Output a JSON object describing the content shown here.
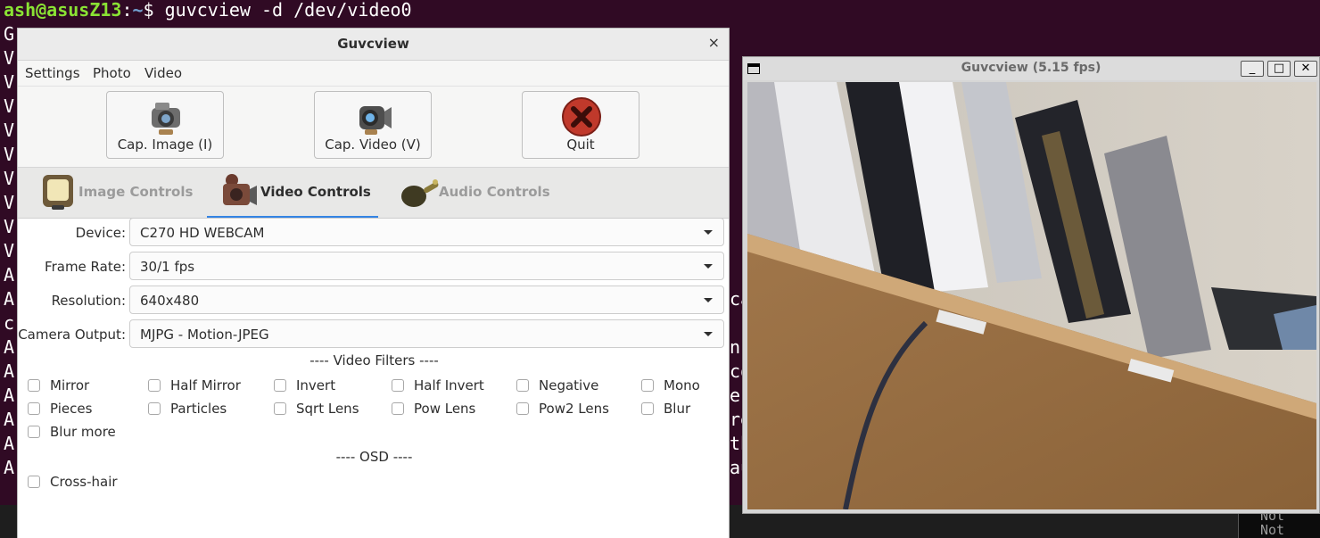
{
  "terminal": {
    "prompt_user": "ash@asusZ13",
    "prompt_sep": ":",
    "prompt_path": "~",
    "prompt_dollar": "$",
    "command": "guvcview -d /dev/video0",
    "left_fragments": [
      "G",
      "V",
      "V",
      "V",
      "V",
      "V",
      "V",
      "V",
      "V",
      "V",
      "A",
      "A",
      "c",
      "A",
      "A",
      "A",
      "A",
      "A",
      "A"
    ],
    "right_fragments": [
      "ca",
      "n",
      "co",
      "e",
      "re",
      "th",
      "au"
    ],
    "notification": [
      "Not",
      "Not"
    ]
  },
  "control_window": {
    "title": "Guvcview",
    "close_glyph": "×",
    "menu": [
      "Settings",
      "Photo",
      "Video"
    ],
    "toolbar": {
      "capture_image": "Cap. Image (I)",
      "capture_video": "Cap. Video (V)",
      "quit": "Quit"
    },
    "tabs": [
      {
        "label": "Image Controls",
        "active": false
      },
      {
        "label": "Video Controls",
        "active": true
      },
      {
        "label": "Audio Controls",
        "active": false
      }
    ],
    "form": {
      "device_label": "Device:",
      "device_value": "C270 HD WEBCAM",
      "frame_rate_label": "Frame Rate:",
      "frame_rate_value": "30/1 fps",
      "resolution_label": "Resolution:",
      "resolution_value": "640x480",
      "camera_output_label": "Camera Output:",
      "camera_output_value": "MJPG - Motion-JPEG"
    },
    "video_filters_title": "---- Video Filters ----",
    "filters": {
      "mirror": "Mirror",
      "half_mirror": "Half Mirror",
      "invert": "Invert",
      "half_invert": "Half Invert",
      "negative": "Negative",
      "mono": "Mono",
      "pieces": "Pieces",
      "particles": "Particles",
      "sqrt_lens": "Sqrt Lens",
      "pow_lens": "Pow Lens",
      "pow2_lens": "Pow2 Lens",
      "blur": "Blur",
      "blur_more": "Blur more"
    },
    "osd_title": "---- OSD ----",
    "osd": {
      "cross_hair": "Cross-hair"
    }
  },
  "preview_window": {
    "title": "Guvcview  (5.15 fps)",
    "minimize": "_",
    "maximize": "□",
    "close": "✕"
  },
  "colors": {
    "terminal_bg": "#300a24",
    "prompt_user": "#8ae234",
    "prompt_path": "#729fcf",
    "tab_underline": "#3584e4",
    "quit_red": "#c0392b"
  }
}
